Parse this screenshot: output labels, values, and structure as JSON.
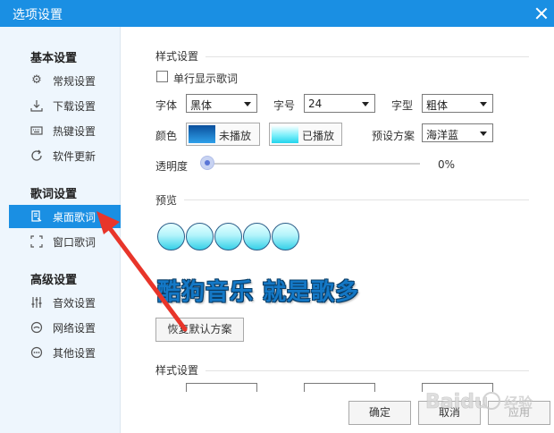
{
  "window": {
    "title": "选项设置"
  },
  "sidebar": {
    "groups": [
      {
        "title": "基本设置",
        "items": [
          {
            "label": "常规设置",
            "icon": "gear-icon"
          },
          {
            "label": "下载设置",
            "icon": "download-icon"
          },
          {
            "label": "热键设置",
            "icon": "keyboard-icon"
          },
          {
            "label": "软件更新",
            "icon": "update-icon"
          }
        ]
      },
      {
        "title": "歌词设置",
        "items": [
          {
            "label": "桌面歌词",
            "icon": "desktop-lyrics-icon",
            "active": true
          },
          {
            "label": "窗口歌词",
            "icon": "window-lyrics-icon"
          }
        ]
      },
      {
        "title": "高级设置",
        "items": [
          {
            "label": "音效设置",
            "icon": "equalizer-icon"
          },
          {
            "label": "网络设置",
            "icon": "network-icon"
          },
          {
            "label": "其他设置",
            "icon": "more-icon"
          }
        ]
      }
    ]
  },
  "style": {
    "section_title": "样式设置",
    "single_line_label": "单行显示歌词",
    "single_line_checked": false,
    "font_label": "字体",
    "font_value": "黑体",
    "size_label": "字号",
    "size_value": "24",
    "weight_label": "字型",
    "weight_value": "粗体",
    "color_label": "颜色",
    "unplayed_label": "未播放",
    "played_label": "已播放",
    "preset_label": "预设方案",
    "preset_value": "海洋蓝",
    "opacity_label": "透明度",
    "opacity_value": "0%",
    "opacity_fraction": 0
  },
  "preview": {
    "section_title": "预览",
    "bubble_count": 5,
    "lyric_text": "酷狗音乐 就是歌多",
    "reset_label": "恢复默认方案"
  },
  "style2": {
    "section_title": "样式设置"
  },
  "footer": {
    "ok_label": "确定",
    "cancel_label": "取消",
    "apply_label": "应用"
  },
  "colors": {
    "accent": "#1a8fe3",
    "sidebar_bg": "#eef6fd",
    "arrow": "#e8352a",
    "lyric_fill": "#1478c6"
  }
}
